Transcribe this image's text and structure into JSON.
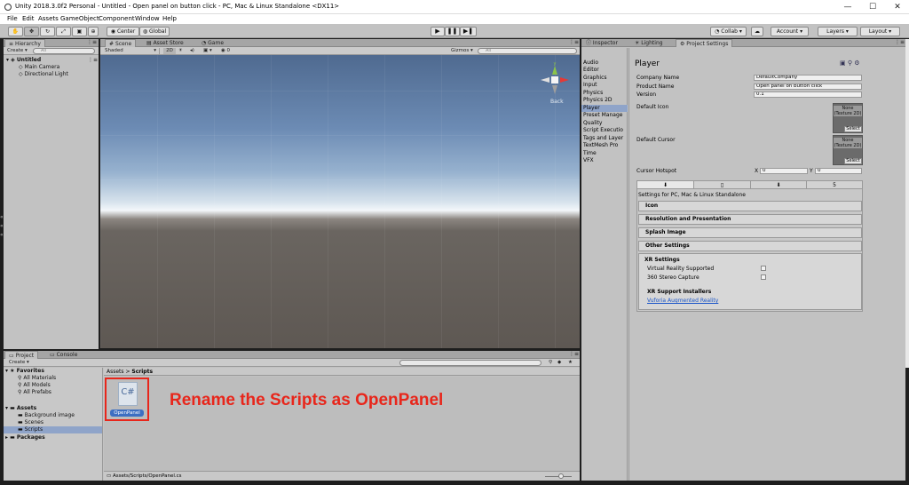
{
  "window": {
    "title": "Unity 2018.3.0f2 Personal - Untitled - Open panel on button click - PC, Mac & Linux Standalone <DX11>",
    "minimize": "—",
    "maximize": "☐",
    "close": "✕"
  },
  "menu": [
    "File",
    "Edit",
    "Assets",
    "GameObject",
    "Component",
    "Window",
    "Help"
  ],
  "toolbar": {
    "pivot": "Center",
    "space": "Global",
    "collab": "Collab",
    "account": "Account",
    "layers": "Layers",
    "layout": "Layout"
  },
  "hierarchy": {
    "tab": "Hierarchy",
    "create": "Create",
    "search": "All",
    "scene": "Untitled",
    "items": [
      "Main Camera",
      "Directional Light"
    ]
  },
  "scene": {
    "tabs": [
      "Scene",
      "Asset Store",
      "Game"
    ],
    "shading": "Shaded",
    "mode2d": "2D",
    "gizmos": "Gizmos",
    "search": "All",
    "back_label": "Back",
    "axis_y": "y"
  },
  "project": {
    "tabs": [
      "Project",
      "Console"
    ],
    "create": "Create",
    "favorites_label": "Favorites",
    "favorites": [
      "All Materials",
      "All Models",
      "All Prefabs"
    ],
    "assets_label": "Assets",
    "asset_folders": [
      "Background image",
      "Scenes",
      "Scripts"
    ],
    "packages_label": "Packages",
    "breadcrumb_root": "Assets",
    "breadcrumb_sep": ">",
    "breadcrumb_current": "Scripts",
    "file_icon_text": "C#",
    "file_name": "OpenPanel",
    "status_path": "Assets/Scripts/OpenPanel.cs"
  },
  "annotation": {
    "text": "Rename the Scripts as OpenPanel",
    "color": "#e8261b"
  },
  "inspector": {
    "tabs": [
      "Inspector",
      "Lighting",
      "Project Settings"
    ],
    "categories": [
      "Audio",
      "Editor",
      "Graphics",
      "Input",
      "Physics",
      "Physics 2D",
      "Player",
      "Preset Manage",
      "Quality",
      "Script Executio",
      "Tags and Layer",
      "TextMesh Pro",
      "Time",
      "VFX"
    ],
    "selected_category": "Player",
    "heading": "Player",
    "company_label": "Company Name",
    "company_value": "DefaultCompany",
    "product_label": "Product Name",
    "product_value": "Open panel on button click",
    "version_label": "Version",
    "version_value": "0.1",
    "default_icon_label": "Default Icon",
    "default_cursor_label": "Default Cursor",
    "texture_none": "None (Texture 2D)",
    "select_label": "Select",
    "hotspot_label": "Cursor Hotspot",
    "hotspot_x_label": "X",
    "hotspot_x": "0",
    "hotspot_y_label": "Y",
    "hotspot_y": "0",
    "platform_settings_label": "Settings for PC, Mac & Linux Standalone",
    "sections": [
      "Icon",
      "Resolution and Presentation",
      "Splash Image",
      "Other Settings"
    ],
    "xr_heading": "XR Settings",
    "xr_vr": "Virtual Reality Supported",
    "xr_stereo": "360 Stereo Capture",
    "xr_installers": "XR Support Installers",
    "xr_link": "Vuforia Augmented Reality"
  }
}
